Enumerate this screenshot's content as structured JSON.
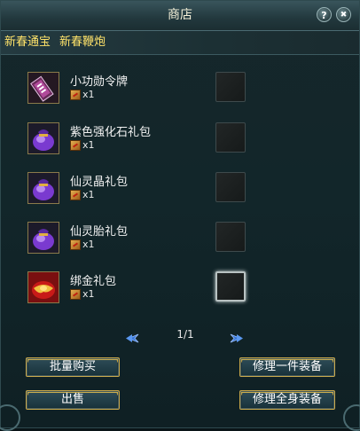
{
  "window": {
    "title": "商店",
    "help_glyph": "?",
    "close_glyph": "✖"
  },
  "tabs": [
    {
      "label": "新春通宝"
    },
    {
      "label": "新春鞭炮"
    }
  ],
  "items": [
    {
      "name": "小功勋令牌",
      "qty": "x1",
      "icon": "token-scroll-icon"
    },
    {
      "name": "紫色强化石礼包",
      "qty": "x1",
      "icon": "purple-bag-icon"
    },
    {
      "name": "仙灵晶礼包",
      "qty": "x1",
      "icon": "purple-bag-icon"
    },
    {
      "name": "仙灵胎礼包",
      "qty": "x1",
      "icon": "purple-bag-icon"
    },
    {
      "name": "绑金礼包",
      "qty": "x1",
      "icon": "red-gold-bag-icon"
    }
  ],
  "pager": {
    "text": "1/1"
  },
  "buttons": {
    "bulk_buy": "批量购买",
    "repair_one": "修理一件装备",
    "sell": "出售",
    "repair_all": "修理全身装备"
  },
  "colors": {
    "tab_text": "#ffe36a",
    "button_border": "#c9a94c",
    "panel_bg": "#12262a"
  }
}
